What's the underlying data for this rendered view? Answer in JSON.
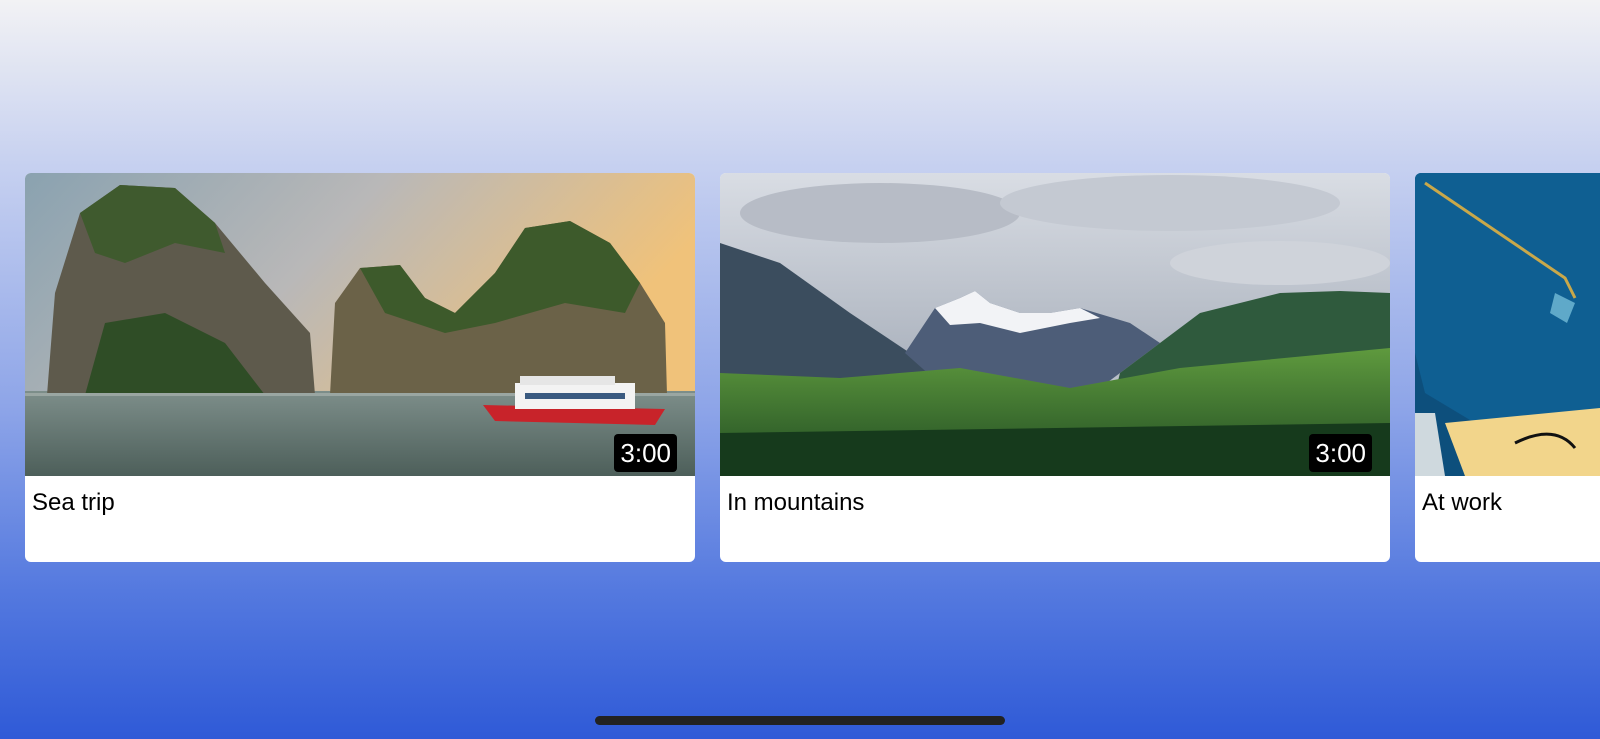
{
  "cards": [
    {
      "title": "Sea trip",
      "duration": "3:00",
      "image": "sea-cliffs-boat"
    },
    {
      "title": "In mountains",
      "duration": "3:00",
      "image": "snowy-mountains-forest"
    },
    {
      "title": "At work",
      "duration": "",
      "image": "blue-bag-notebook"
    }
  ],
  "colors": {
    "background_top": "#f2f2f4",
    "background_bottom": "#2f5ad7",
    "card": "#ffffff",
    "duration_badge": "#000000",
    "home_indicator": "#222222"
  }
}
